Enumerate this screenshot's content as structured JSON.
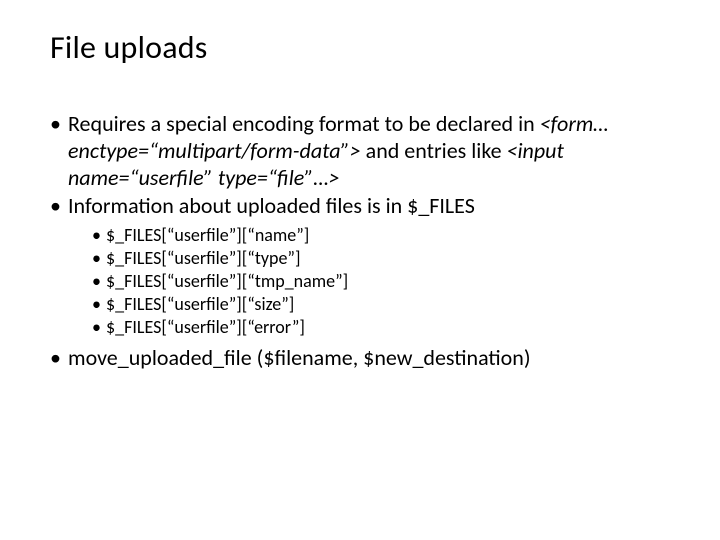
{
  "title": "File uploads",
  "bullets": {
    "b1_pre": "Requires a special encoding format to be declared in ",
    "b1_form": "<form…enctype=“multipart/form-data”>",
    "b1_mid": " and entries like ",
    "b1_input": "<input name=“userfile” type=“file”…>",
    "b2": "Information about uploaded files is in $_FILES",
    "sub": [
      "$_FILES[“userfile”][“name”]",
      "$_FILES[“userfile”][“type”]",
      "$_FILES[“userfile”][“tmp_name”]",
      "$_FILES[“userfile”][“size”]",
      "$_FILES[“userfile”][“error”]"
    ],
    "b3": "move_uploaded_file ($filename, $new_destination)"
  }
}
